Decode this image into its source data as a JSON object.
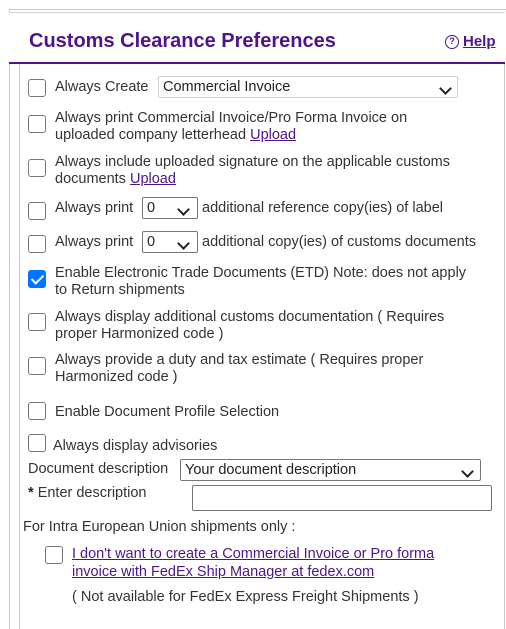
{
  "header": {
    "title": "Customs Clearance Preferences",
    "help_label": "Help",
    "help_icon": "question-circle-icon"
  },
  "options": {
    "always_create": {
      "label": "Always Create",
      "select_value": "Commercial Invoice",
      "checked": false
    },
    "letterhead": {
      "line1": "Always print Commercial Invoice/Pro Forma Invoice on",
      "line2": "uploaded company letterhead",
      "link": "Upload",
      "checked": false
    },
    "signature": {
      "line1": "Always include uploaded signature on the applicable customs",
      "line2": "documents",
      "link": "Upload",
      "checked": false
    },
    "reference_copies": {
      "before": "Always print",
      "value": "0",
      "after": "additional reference copy(ies) of label",
      "checked": false
    },
    "customs_copies": {
      "before": "Always print",
      "value": "0",
      "after": "additional copy(ies) of customs documents",
      "checked": false
    },
    "etd": {
      "line1": "Enable Electronic Trade Documents (ETD) Note: does not apply",
      "line2": "to Return shipments",
      "checked": true
    },
    "additional_docs": {
      "line1": "Always display additional customs documentation ( Requires",
      "line2": "proper Harmonized code )",
      "checked": false
    },
    "duty_estimate": {
      "line1": "Always provide a duty and tax estimate ( Requires proper",
      "line2": "Harmonized code )",
      "checked": false
    },
    "document_profile": {
      "label": "Enable Document Profile Selection",
      "checked": false
    },
    "advisories": {
      "label": "Always display advisories",
      "checked": false
    }
  },
  "document_description": {
    "label": "Document description",
    "select_value": "Your document description",
    "required_mark": "*",
    "enter_label": "Enter description",
    "input_value": ""
  },
  "eu_section": {
    "heading": "For Intra European Union shipments only :",
    "link_line1": "I don't want to create a Commercial Invoice or Pro forma",
    "link_line2": "invoice with FedEx Ship Manager at fedex.com",
    "note": "( Not available for FedEx Express Freight Shipments )",
    "checked": false
  },
  "colors": {
    "brand": "#4d148c",
    "checkbox_checked": "#0075ff"
  }
}
